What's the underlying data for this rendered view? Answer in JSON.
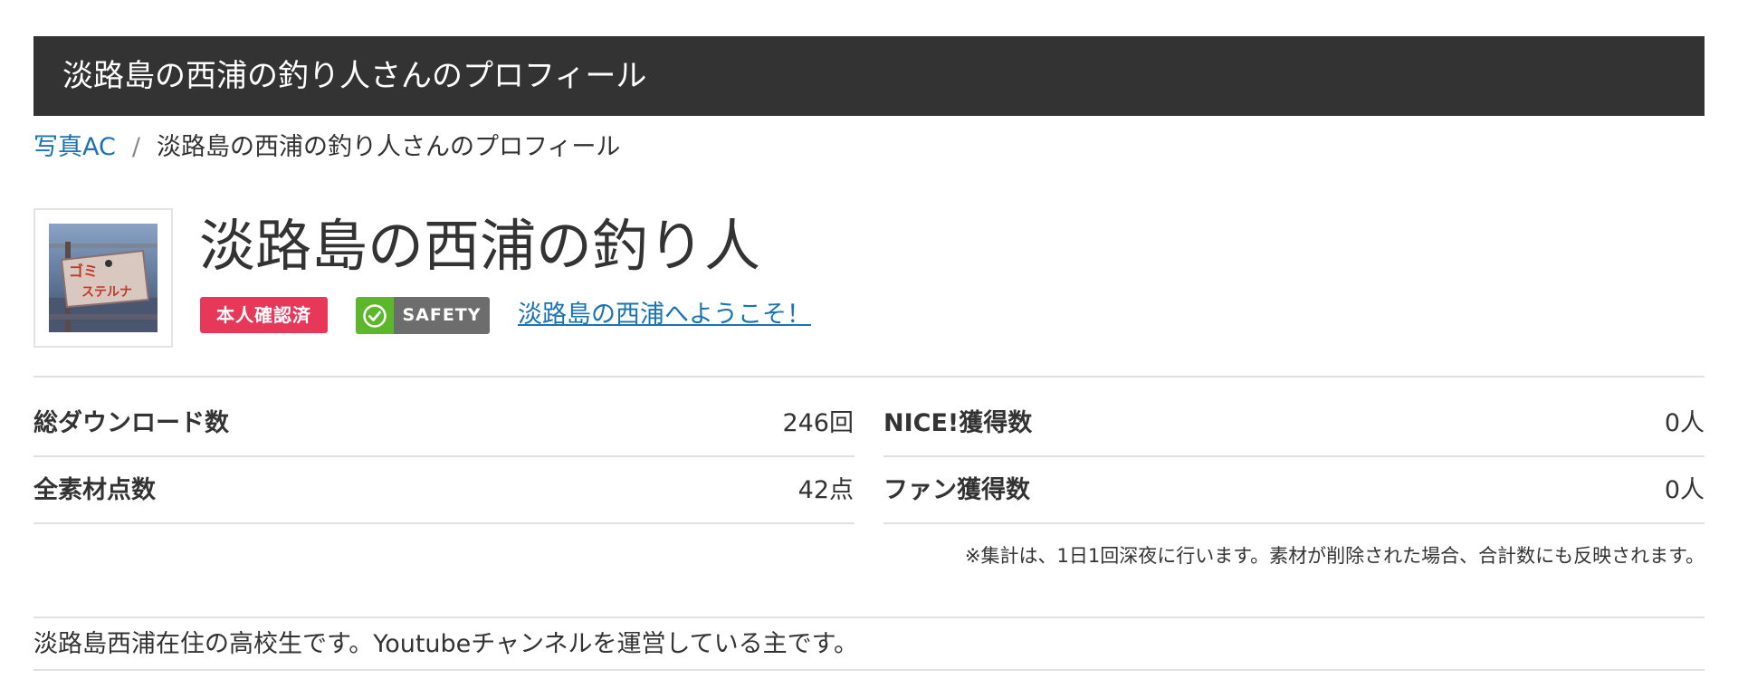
{
  "header": {
    "title": "淡路島の西浦の釣り人さんのプロフィール"
  },
  "breadcrumb": {
    "home_label": "写真AC",
    "separator": "/",
    "current_label": "淡路島の西浦の釣り人さんのプロフィール"
  },
  "profile": {
    "name": "淡路島の西浦の釣り人",
    "verified_badge": "本人確認済",
    "safety_badge": "SAFETY",
    "catchphrase": "淡路島の西浦へようこそ！",
    "avatar_sign_text": "ゴミ ステルナ"
  },
  "stats": {
    "downloads": {
      "label": "総ダウンロード数",
      "value": "246回"
    },
    "nice": {
      "label": "NICE!獲得数",
      "value": "0人"
    },
    "materials": {
      "label": "全素材点数",
      "value": "42点"
    },
    "fans": {
      "label": "ファン獲得数",
      "value": "0人"
    },
    "note": "※集計は、1日1回深夜に行います。素材が削除された場合、合計数にも反映されます。"
  },
  "bio": "淡路島西浦在住の高校生です。Youtubeチャンネルを運営している主です。",
  "colors": {
    "header_bg": "#333333",
    "link": "#1a73b5",
    "verified_badge_bg": "#e8385a",
    "safety_check_bg": "#5cb82a",
    "safety_text_bg": "#6d6d6d",
    "divider": "#e0e0e0"
  }
}
